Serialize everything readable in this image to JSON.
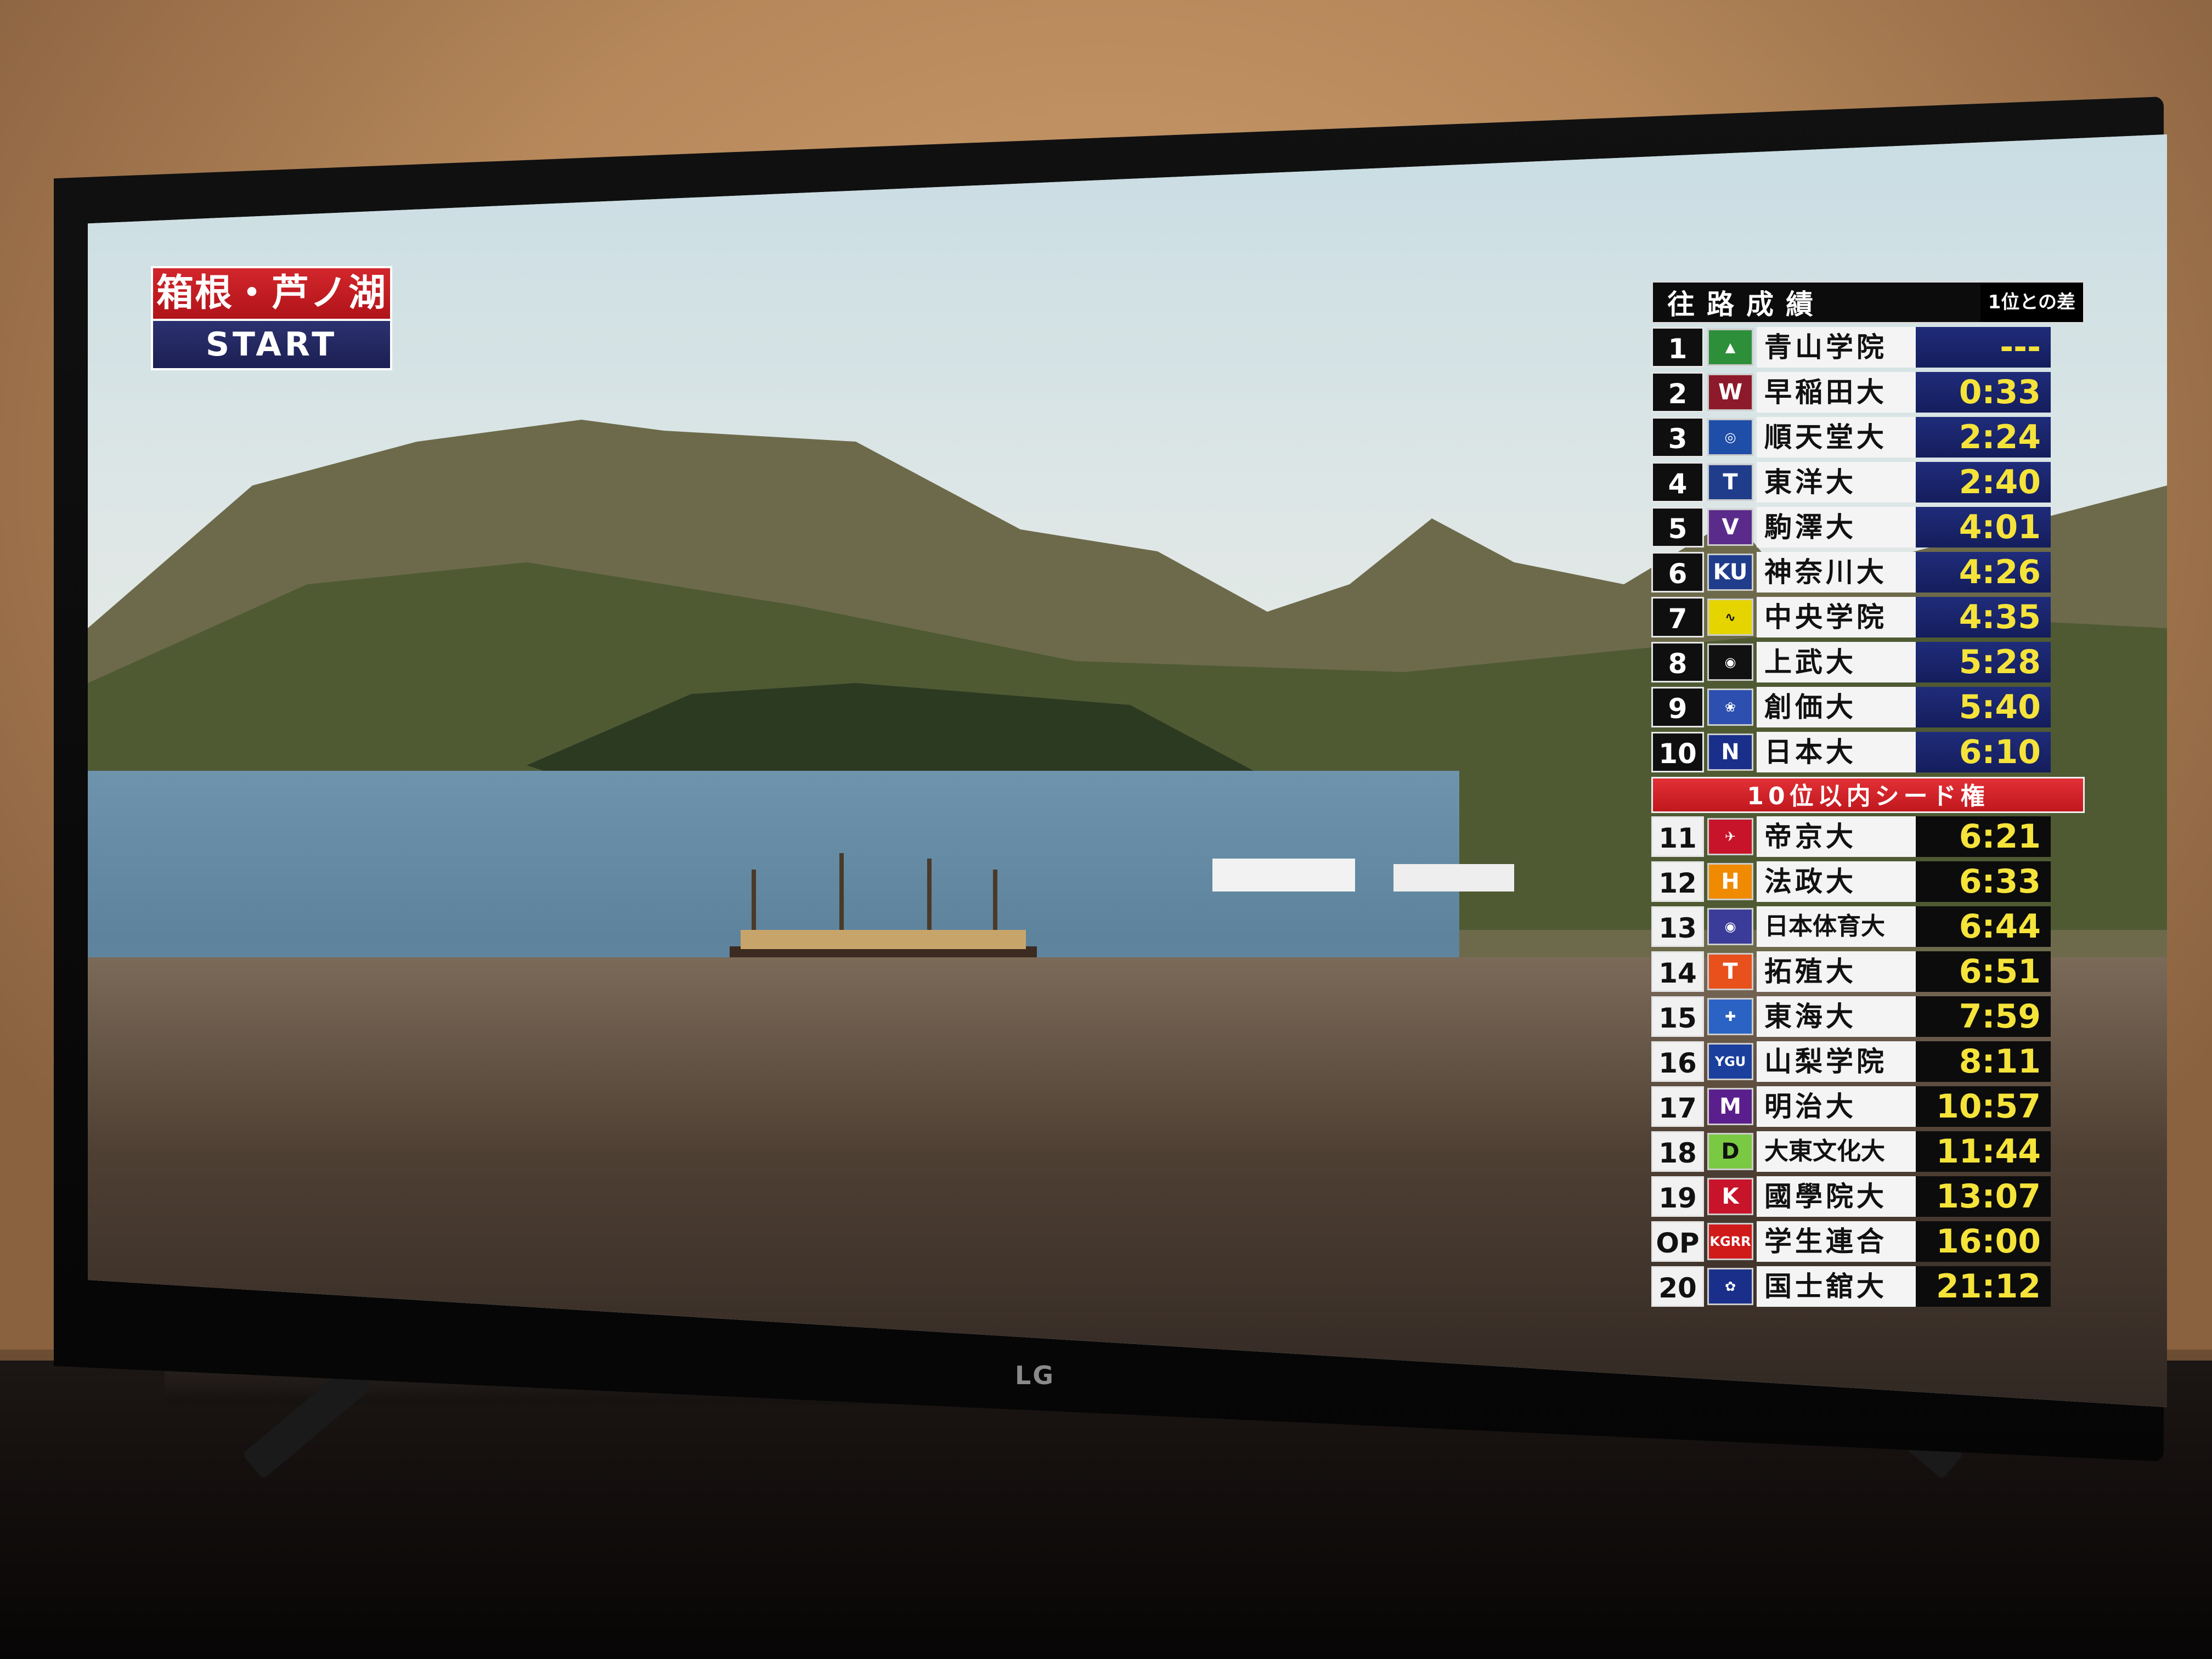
{
  "location_badge": {
    "place": "箱根・芦ノ湖",
    "status": "START"
  },
  "standings": {
    "title": "往路成績",
    "subtitle": "1位との差",
    "seed_label": "10位以内シード権",
    "rows_top": [
      {
        "rank": "1",
        "team": "青山学院",
        "gap": "---",
        "logo": "shield",
        "logo_color": "#2e8f3a"
      },
      {
        "rank": "2",
        "team": "早稲田大",
        "gap": "0:33",
        "logo": "W",
        "logo_color": "#8c1a2a"
      },
      {
        "rank": "3",
        "team": "順天堂大",
        "gap": "2:24",
        "logo": "circle-j",
        "logo_color": "#1f4ea8"
      },
      {
        "rank": "4",
        "team": "東洋大",
        "gap": "2:40",
        "logo": "T",
        "logo_color": "#1f3d8a"
      },
      {
        "rank": "5",
        "team": "駒澤大",
        "gap": "4:01",
        "logo": "V",
        "logo_color": "#5b2b8c"
      },
      {
        "rank": "6",
        "team": "神奈川大",
        "gap": "4:26",
        "logo": "KU",
        "logo_color": "#1f3d8a"
      },
      {
        "rank": "7",
        "team": "中央学院",
        "gap": "4:35",
        "logo": "wave",
        "logo_color": "#e5d400"
      },
      {
        "rank": "8",
        "team": "上武大",
        "gap": "5:28",
        "logo": "crest",
        "logo_color": "#111111"
      },
      {
        "rank": "9",
        "team": "創価大",
        "gap": "5:40",
        "logo": "flame",
        "logo_color": "#2c4fb0"
      },
      {
        "rank": "10",
        "team": "日本大",
        "gap": "6:10",
        "logo": "N",
        "logo_color": "#1a2f8a"
      }
    ],
    "rows_bottom": [
      {
        "rank": "11",
        "team": "帝京大",
        "gap": "6:21",
        "logo": "bird",
        "logo_color": "#c8142a"
      },
      {
        "rank": "12",
        "team": "法政大",
        "gap": "6:33",
        "logo": "H",
        "logo_color": "#f08a00"
      },
      {
        "rank": "13",
        "team": "日本体育大",
        "gap": "6:44",
        "logo": "crest",
        "logo_color": "#3b3b9a"
      },
      {
        "rank": "14",
        "team": "拓殖大",
        "gap": "6:51",
        "logo": "T",
        "logo_color": "#e8501c"
      },
      {
        "rank": "15",
        "team": "東海大",
        "gap": "7:59",
        "logo": "cross",
        "logo_color": "#2a63c4"
      },
      {
        "rank": "16",
        "team": "山梨学院",
        "gap": "8:11",
        "logo": "YGU",
        "logo_color": "#1a3f9c"
      },
      {
        "rank": "17",
        "team": "明治大",
        "gap": "10:57",
        "logo": "M",
        "logo_color": "#5a1f8c"
      },
      {
        "rank": "18",
        "team": "大東文化大",
        "gap": "11:44",
        "logo": "D",
        "logo_color": "#7ac943"
      },
      {
        "rank": "19",
        "team": "國學院大",
        "gap": "13:07",
        "logo": "K",
        "logo_color": "#c8142a"
      },
      {
        "rank": "OP",
        "team": "学生連合",
        "gap": "16:00",
        "logo": "KGRR",
        "logo_color": "#d01a1a"
      },
      {
        "rank": "20",
        "team": "国士舘大",
        "gap": "21:12",
        "logo": "sakura",
        "logo_color": "#1a2f8a"
      }
    ]
  },
  "tv": {
    "brand": "LG"
  }
}
